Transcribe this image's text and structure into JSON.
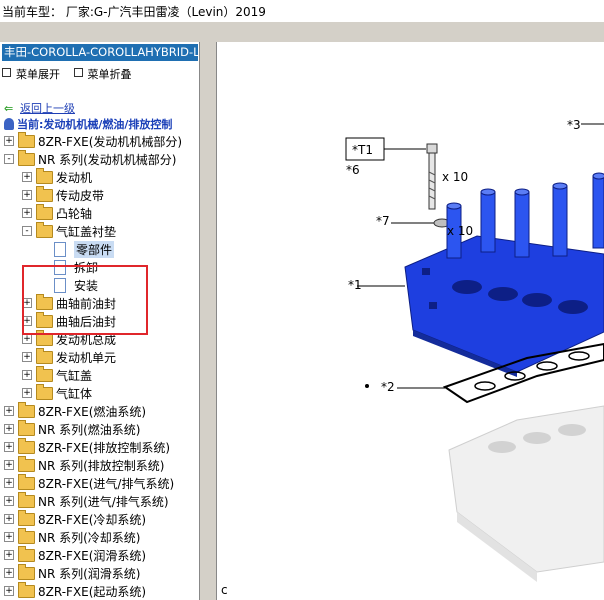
{
  "topbar": {
    "text": "当前车型： 厂家:G-广汽丰田雷凌（Levin）2019"
  },
  "left": {
    "title": "丰田-COROLLA-COROLLAHYBRID-L",
    "menu": {
      "expand": "菜单展开",
      "collapse": "菜单折叠"
    },
    "back": "返回上一级",
    "current": "当前:发动机机械/燃油/排放控制"
  },
  "tree": [
    {
      "label": "8ZR-FXE(发动机机械部分)",
      "type": "folder",
      "expander": "+"
    },
    {
      "label": "NR 系列(发动机机械部分)",
      "type": "folder",
      "expander": "-"
    },
    {
      "label": "发动机",
      "type": "folder",
      "expander": "+"
    },
    {
      "label": "传动皮带",
      "type": "folder",
      "expander": "+"
    },
    {
      "label": "凸轮轴",
      "type": "folder",
      "expander": "+"
    },
    {
      "label": "气缸盖衬垫",
      "type": "folder",
      "expander": "-"
    },
    {
      "label": "零部件",
      "type": "doc",
      "expander": "",
      "selected": true
    },
    {
      "label": "拆卸",
      "type": "doc",
      "expander": ""
    },
    {
      "label": "安装",
      "type": "doc",
      "expander": ""
    },
    {
      "label": "曲轴前油封",
      "type": "folder",
      "expander": "+"
    },
    {
      "label": "曲轴后油封",
      "type": "folder",
      "expander": "+"
    },
    {
      "label": "发动机总成",
      "type": "folder",
      "expander": "+"
    },
    {
      "label": "发动机单元",
      "type": "folder",
      "expander": "+"
    },
    {
      "label": "气缸盖",
      "type": "folder",
      "expander": "+"
    },
    {
      "label": "气缸体",
      "type": "folder",
      "expander": "+"
    },
    {
      "label": "8ZR-FXE(燃油系统)",
      "type": "folder",
      "expander": "+"
    },
    {
      "label": "NR 系列(燃油系统)",
      "type": "folder",
      "expander": "+"
    },
    {
      "label": "8ZR-FXE(排放控制系统)",
      "type": "folder",
      "expander": "+"
    },
    {
      "label": "NR 系列(排放控制系统)",
      "type": "folder",
      "expander": "+"
    },
    {
      "label": "8ZR-FXE(进气/排气系统)",
      "type": "folder",
      "expander": "+"
    },
    {
      "label": "NR 系列(进气/排气系统)",
      "type": "folder",
      "expander": "+"
    },
    {
      "label": "8ZR-FXE(冷却系统)",
      "type": "folder",
      "expander": "+"
    },
    {
      "label": "NR 系列(冷却系统)",
      "type": "folder",
      "expander": "+"
    },
    {
      "label": "8ZR-FXE(润滑系统)",
      "type": "folder",
      "expander": "+"
    },
    {
      "label": "NR 系列(润滑系统)",
      "type": "folder",
      "expander": "+"
    },
    {
      "label": "8ZR-FXE(起动系统)",
      "type": "folder",
      "expander": "+"
    }
  ],
  "diagram": {
    "c3": "*3",
    "t1": "*T1",
    "c6": "*6",
    "x10a": "x 10",
    "c7": "*7",
    "x10b": "x 10",
    "c1": "*1",
    "c2": "*2",
    "bottom": "c"
  },
  "colors": {
    "accent": "#1f6fb2",
    "highlight": "#e0262b",
    "head": "#1e3fe0"
  }
}
